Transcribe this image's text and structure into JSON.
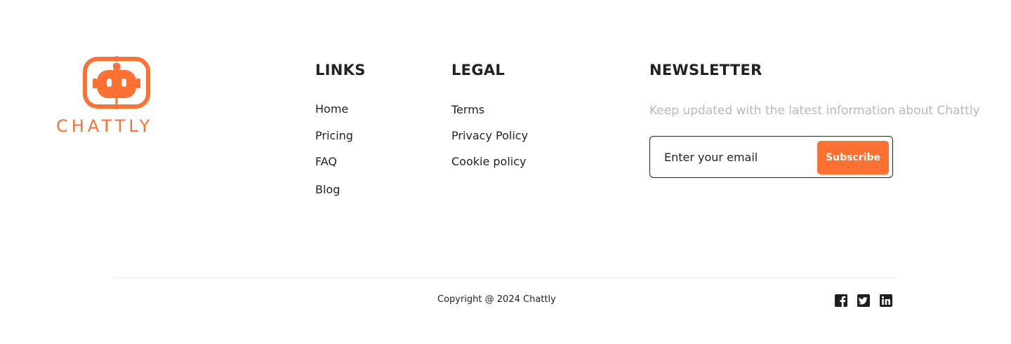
{
  "brand": {
    "name": "CHATTLY",
    "accent_color": "#FF7033",
    "logo_icon": "robot-icon"
  },
  "links": {
    "title": "LINKS",
    "items": [
      "Home",
      "Pricing",
      "FAQ",
      "Blog"
    ]
  },
  "legal": {
    "title": "LEGAL",
    "items": [
      "Terms",
      "Privacy Policy",
      "Cookie policy"
    ]
  },
  "newsletter": {
    "title": "NEWSLETTER",
    "description": "Keep  updated with the latest information about Chattly",
    "email_placeholder": "Enter your email",
    "subscribe_label": "Subscribe"
  },
  "footer": {
    "copyright": "Copyright @ 2024 Chattly",
    "socials": [
      "facebook-icon",
      "twitter-icon",
      "linkedin-icon"
    ]
  }
}
